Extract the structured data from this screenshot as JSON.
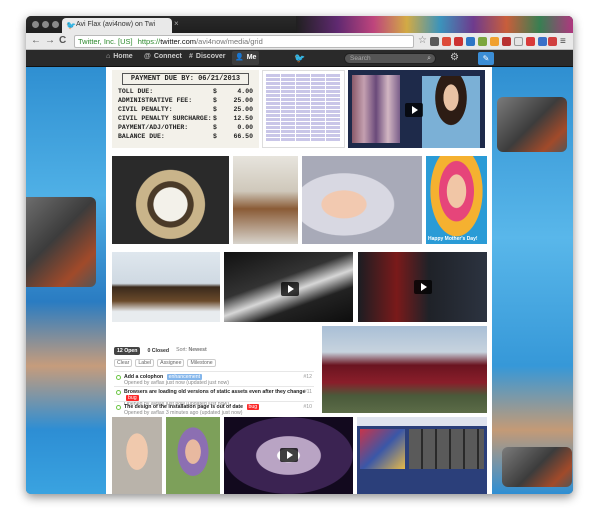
{
  "browser": {
    "tab_title": "Avi Flax (avi4now) on Twi",
    "tab_close": "×",
    "url_ssl": "Twitter, Inc. [US]",
    "url_scheme": "https://",
    "url_host": "twitter.com",
    "url_path": "/avi4now/media/grid",
    "back": "←",
    "forward": "→",
    "reload": "C",
    "star": "☆",
    "menu": "≡"
  },
  "twitter_nav": {
    "home": "Home",
    "connect": "Connect",
    "discover": "Discover",
    "me": "Me",
    "search_placeholder": "Search",
    "gear": "⚙",
    "compose": "✎"
  },
  "receipt": {
    "title": "PAYMENT DUE BY: 06/21/2013",
    "lines": [
      {
        "label": "TOLL DUE:",
        "cur": "$",
        "amount": "4.00"
      },
      {
        "label": "ADMINISTRATIVE FEE:",
        "cur": "$",
        "amount": "25.00"
      },
      {
        "label": "CIVIL PENALTY:",
        "cur": "$",
        "amount": "25.00"
      },
      {
        "label": "CIVIL PENALTY SURCHARGE:",
        "cur": "$",
        "amount": "12.50"
      },
      {
        "label": "PAYMENT/ADJ/OTHER:",
        "cur": "$",
        "amount": "0.00"
      },
      {
        "label": "BALANCE DUE:",
        "cur": "$",
        "amount": "66.50"
      }
    ]
  },
  "photo_caption": "Happy Mother's Day!",
  "issues": {
    "open_tab": "12 Open",
    "closed_tab": "0 Closed",
    "sort_label": "Sort:",
    "sort_value": "Newest",
    "filters": [
      "Clear",
      "Label",
      "Assignee",
      "Milestone"
    ],
    "items": [
      {
        "title": "Add a colophon",
        "label": "enhancement",
        "label_color": "#84b6eb",
        "meta": "Opened by avflax just now (updated just now)",
        "number": "#12"
      },
      {
        "title": "Browsers are loading old versions of static assets even after they change",
        "label": "bug",
        "label_color": "#fc2929",
        "meta": "Opened by avflax just now (updated just now)",
        "number": "#11"
      },
      {
        "title": "The design of the installation page is out of date",
        "label": "bug",
        "label_color": "#fc2929",
        "meta": "Opened by avflax 3 minutes ago (updated just now)",
        "number": "#10"
      }
    ]
  },
  "colors": {
    "chrome_dark": "#2a2a2a",
    "twitter_blue": "#3b8ed6",
    "background_sky": "#5aa7d8"
  }
}
